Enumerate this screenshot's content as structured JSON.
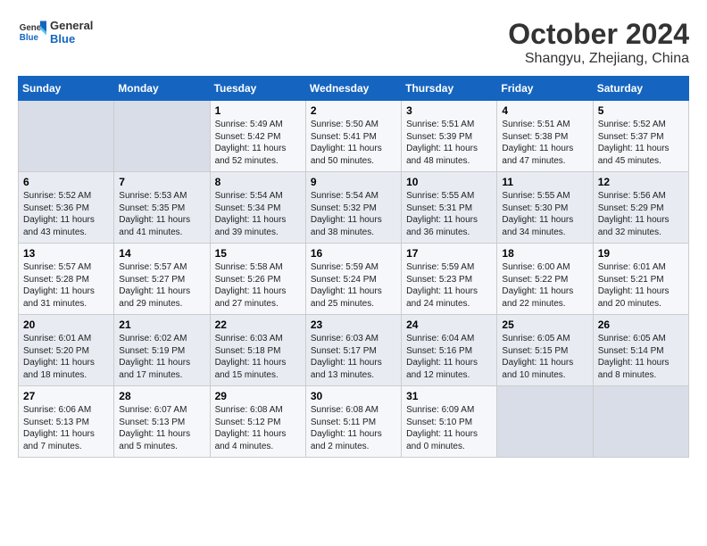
{
  "logo": {
    "line1": "General",
    "line2": "Blue"
  },
  "title": "October 2024",
  "subtitle": "Shangyu, Zhejiang, China",
  "days_of_week": [
    "Sunday",
    "Monday",
    "Tuesday",
    "Wednesday",
    "Thursday",
    "Friday",
    "Saturday"
  ],
  "weeks": [
    [
      {
        "day": "",
        "info": ""
      },
      {
        "day": "",
        "info": ""
      },
      {
        "day": "1",
        "info": "Sunrise: 5:49 AM\nSunset: 5:42 PM\nDaylight: 11 hours and 52 minutes."
      },
      {
        "day": "2",
        "info": "Sunrise: 5:50 AM\nSunset: 5:41 PM\nDaylight: 11 hours and 50 minutes."
      },
      {
        "day": "3",
        "info": "Sunrise: 5:51 AM\nSunset: 5:39 PM\nDaylight: 11 hours and 48 minutes."
      },
      {
        "day": "4",
        "info": "Sunrise: 5:51 AM\nSunset: 5:38 PM\nDaylight: 11 hours and 47 minutes."
      },
      {
        "day": "5",
        "info": "Sunrise: 5:52 AM\nSunset: 5:37 PM\nDaylight: 11 hours and 45 minutes."
      }
    ],
    [
      {
        "day": "6",
        "info": "Sunrise: 5:52 AM\nSunset: 5:36 PM\nDaylight: 11 hours and 43 minutes."
      },
      {
        "day": "7",
        "info": "Sunrise: 5:53 AM\nSunset: 5:35 PM\nDaylight: 11 hours and 41 minutes."
      },
      {
        "day": "8",
        "info": "Sunrise: 5:54 AM\nSunset: 5:34 PM\nDaylight: 11 hours and 39 minutes."
      },
      {
        "day": "9",
        "info": "Sunrise: 5:54 AM\nSunset: 5:32 PM\nDaylight: 11 hours and 38 minutes."
      },
      {
        "day": "10",
        "info": "Sunrise: 5:55 AM\nSunset: 5:31 PM\nDaylight: 11 hours and 36 minutes."
      },
      {
        "day": "11",
        "info": "Sunrise: 5:55 AM\nSunset: 5:30 PM\nDaylight: 11 hours and 34 minutes."
      },
      {
        "day": "12",
        "info": "Sunrise: 5:56 AM\nSunset: 5:29 PM\nDaylight: 11 hours and 32 minutes."
      }
    ],
    [
      {
        "day": "13",
        "info": "Sunrise: 5:57 AM\nSunset: 5:28 PM\nDaylight: 11 hours and 31 minutes."
      },
      {
        "day": "14",
        "info": "Sunrise: 5:57 AM\nSunset: 5:27 PM\nDaylight: 11 hours and 29 minutes."
      },
      {
        "day": "15",
        "info": "Sunrise: 5:58 AM\nSunset: 5:26 PM\nDaylight: 11 hours and 27 minutes."
      },
      {
        "day": "16",
        "info": "Sunrise: 5:59 AM\nSunset: 5:24 PM\nDaylight: 11 hours and 25 minutes."
      },
      {
        "day": "17",
        "info": "Sunrise: 5:59 AM\nSunset: 5:23 PM\nDaylight: 11 hours and 24 minutes."
      },
      {
        "day": "18",
        "info": "Sunrise: 6:00 AM\nSunset: 5:22 PM\nDaylight: 11 hours and 22 minutes."
      },
      {
        "day": "19",
        "info": "Sunrise: 6:01 AM\nSunset: 5:21 PM\nDaylight: 11 hours and 20 minutes."
      }
    ],
    [
      {
        "day": "20",
        "info": "Sunrise: 6:01 AM\nSunset: 5:20 PM\nDaylight: 11 hours and 18 minutes."
      },
      {
        "day": "21",
        "info": "Sunrise: 6:02 AM\nSunset: 5:19 PM\nDaylight: 11 hours and 17 minutes."
      },
      {
        "day": "22",
        "info": "Sunrise: 6:03 AM\nSunset: 5:18 PM\nDaylight: 11 hours and 15 minutes."
      },
      {
        "day": "23",
        "info": "Sunrise: 6:03 AM\nSunset: 5:17 PM\nDaylight: 11 hours and 13 minutes."
      },
      {
        "day": "24",
        "info": "Sunrise: 6:04 AM\nSunset: 5:16 PM\nDaylight: 11 hours and 12 minutes."
      },
      {
        "day": "25",
        "info": "Sunrise: 6:05 AM\nSunset: 5:15 PM\nDaylight: 11 hours and 10 minutes."
      },
      {
        "day": "26",
        "info": "Sunrise: 6:05 AM\nSunset: 5:14 PM\nDaylight: 11 hours and 8 minutes."
      }
    ],
    [
      {
        "day": "27",
        "info": "Sunrise: 6:06 AM\nSunset: 5:13 PM\nDaylight: 11 hours and 7 minutes."
      },
      {
        "day": "28",
        "info": "Sunrise: 6:07 AM\nSunset: 5:13 PM\nDaylight: 11 hours and 5 minutes."
      },
      {
        "day": "29",
        "info": "Sunrise: 6:08 AM\nSunset: 5:12 PM\nDaylight: 11 hours and 4 minutes."
      },
      {
        "day": "30",
        "info": "Sunrise: 6:08 AM\nSunset: 5:11 PM\nDaylight: 11 hours and 2 minutes."
      },
      {
        "day": "31",
        "info": "Sunrise: 6:09 AM\nSunset: 5:10 PM\nDaylight: 11 hours and 0 minutes."
      },
      {
        "day": "",
        "info": ""
      },
      {
        "day": "",
        "info": ""
      }
    ]
  ]
}
